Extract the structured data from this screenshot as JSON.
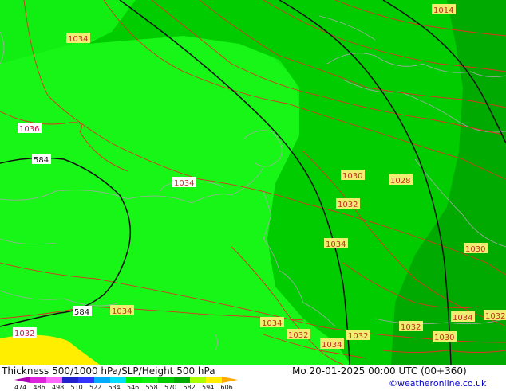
{
  "title": "Thickness 500/1000 hPa/SLP/Height 500 hPa",
  "valid_time": "Mo 20-01-2025 00:00 UTC (00+360)",
  "credit": "©weatheronline.co.uk",
  "colors": {
    "band_534_546": "#11ee11",
    "band_546_558": "#00cc00",
    "band_558_570": "#00aa00",
    "light_patch": "#22ff22",
    "band_low": "#ffee00",
    "isobar": "#dd3322",
    "height_contour": "#111111",
    "coastline": "#a8a8a8"
  },
  "legend": {
    "ticks": [
      "474",
      "486",
      "498",
      "510",
      "522",
      "534",
      "546",
      "558",
      "570",
      "582",
      "594",
      "606"
    ],
    "colors": [
      "#b000b0",
      "#dd22dd",
      "#ff66ff",
      "#2222cc",
      "#3333ff",
      "#00aaff",
      "#00ddff",
      "#00ee00",
      "#11ee11",
      "#00cc00",
      "#00aa00",
      "#aaff00",
      "#ffee00",
      "#ffaa00"
    ]
  },
  "labels": {
    "l1014": "1014",
    "l1034_a": "1034",
    "l1036": "1036",
    "l584_a": "584",
    "l1034_b": "1034",
    "l1030_a": "1030",
    "l1028": "1028",
    "l1032_a": "1032",
    "l1034_c": "1034",
    "l1030_b": "1030",
    "l584_b": "584",
    "l1034_d": "1034",
    "l1032_b": "1032",
    "l1034_e": "1034",
    "l1032_c": "1032",
    "l1032_d": "1032",
    "l1034_f": "1034",
    "l1032_e": "1032",
    "l1034_g": "1034",
    "l1032_f": "1032",
    "l1030_c": "1030"
  }
}
